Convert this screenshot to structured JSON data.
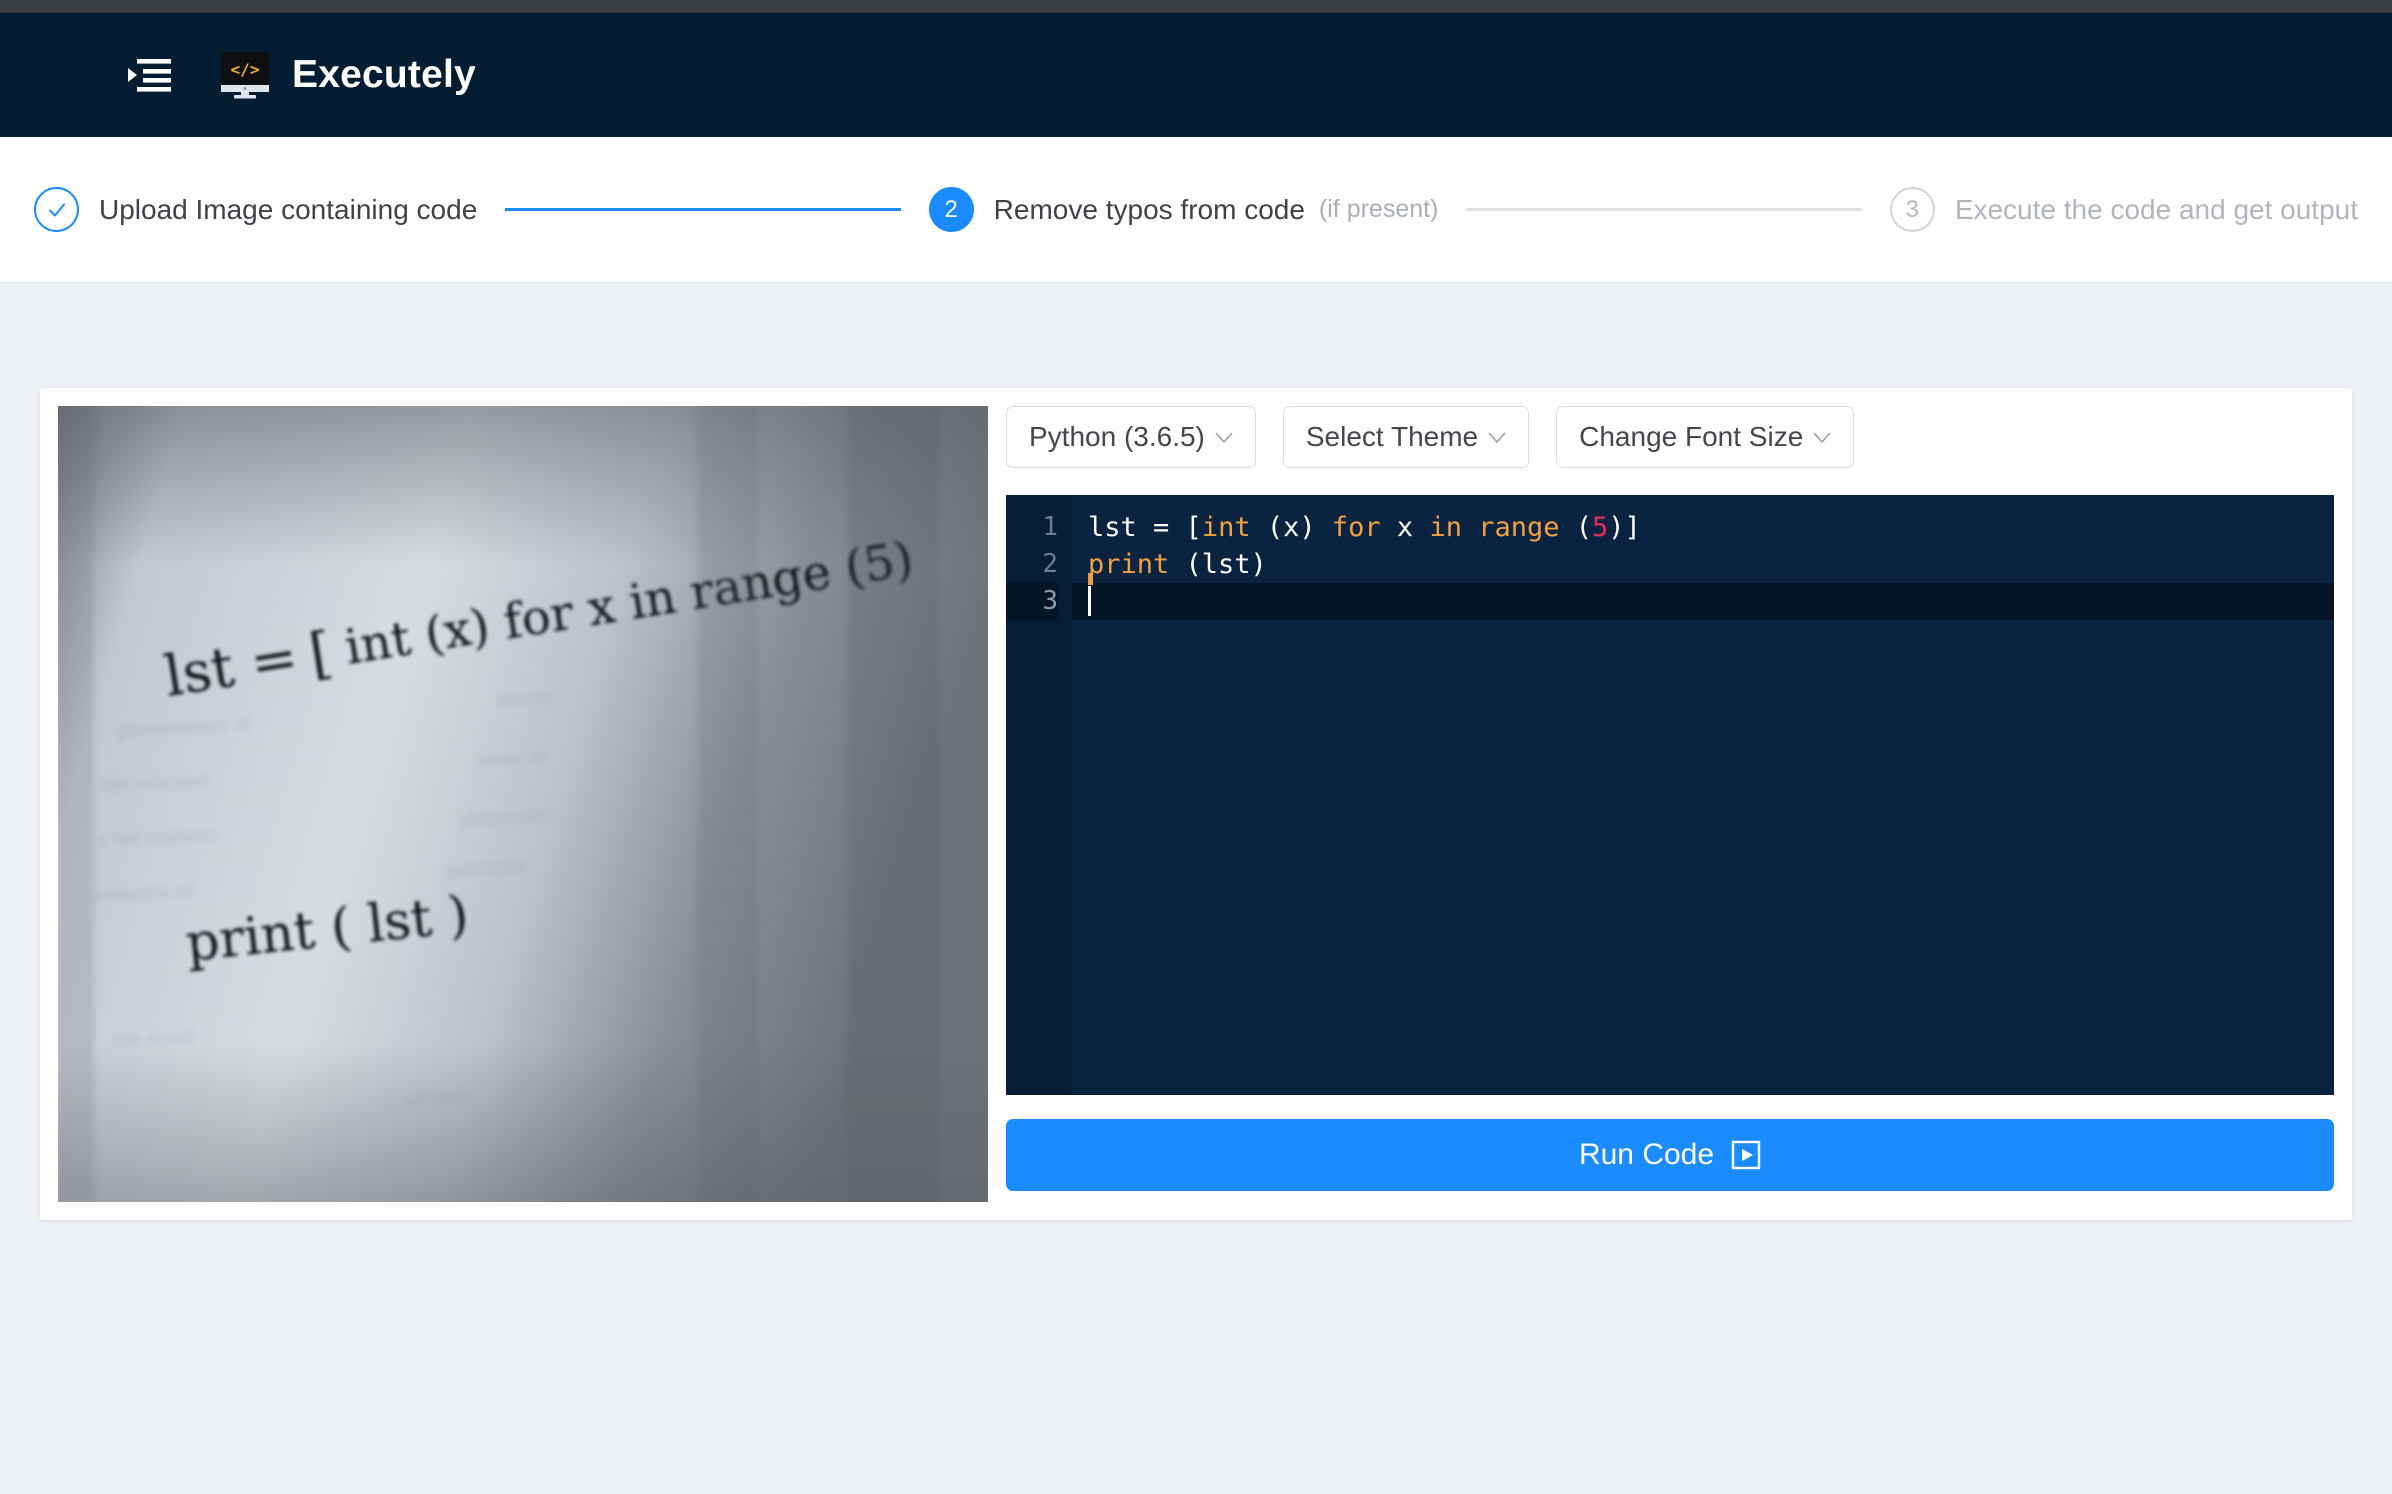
{
  "header": {
    "menu_icon": "indent-list-icon",
    "logo_icon": "monitor-code-icon",
    "title": "Executely",
    "background_color": "#051d33",
    "accent_color": "#1a8cff"
  },
  "stepper": {
    "steps": [
      {
        "number": "1",
        "state": "done",
        "bullet_glyph": "check-icon",
        "label": "Upload Image containing code",
        "sub": ""
      },
      {
        "number": "2",
        "state": "active",
        "bullet_glyph": "2",
        "label": "Remove typos from code",
        "sub": "(if present)"
      },
      {
        "number": "3",
        "state": "todo",
        "bullet_glyph": "3",
        "label": "Execute the code and get output",
        "sub": ""
      }
    ],
    "connectors": [
      "filled",
      "empty"
    ]
  },
  "image_panel": {
    "name": "uploaded-code-photo",
    "alt": "Photograph of handwritten code on a whiteboard",
    "handwritten_lines": [
      "lst = [int(x) for x in range(5)]",
      "print (lst)"
    ]
  },
  "toolbar": {
    "language_select": "Python (3.6.5)",
    "theme_select": "Select Theme",
    "font_size_select": "Change Font Size",
    "caret_icon": "chevron-down-icon"
  },
  "editor": {
    "background_color": "#0a2340",
    "gutter_color": "#071d36",
    "active_line_color": "#041525",
    "keyword_color": "#f0a040",
    "number_color": "#e8305e",
    "text_color": "#ffffff",
    "line_numbers": [
      "1",
      "2",
      "3"
    ],
    "active_line": 3,
    "lines": [
      {
        "number": "1",
        "tokens": [
          {
            "t": "lst ",
            "c": "txt"
          },
          {
            "t": "= ",
            "c": "txt"
          },
          {
            "t": "[",
            "c": "txt"
          },
          {
            "t": "int",
            "c": "kw"
          },
          {
            "t": " (x) ",
            "c": "txt"
          },
          {
            "t": "for",
            "c": "kw"
          },
          {
            "t": " x ",
            "c": "txt"
          },
          {
            "t": "in",
            "c": "kw"
          },
          {
            "t": " ",
            "c": "txt"
          },
          {
            "t": "range",
            "c": "kw"
          },
          {
            "t": " (",
            "c": "txt"
          },
          {
            "t": "5",
            "c": "num"
          },
          {
            "t": ")]",
            "c": "txt"
          }
        ],
        "plain": "lst = [int (x) for x in range (5)]"
      },
      {
        "number": "2",
        "tokens": [
          {
            "t": "print",
            "c": "kw"
          },
          {
            "t": " (lst)",
            "c": "txt"
          }
        ],
        "plain": "print (lst)"
      },
      {
        "number": "3",
        "tokens": [],
        "plain": ""
      }
    ]
  },
  "run_button": {
    "label": "Run Code",
    "icon": "play-in-box-icon",
    "color": "#1a8cff"
  },
  "page": {
    "background_color": "#eef1f5"
  }
}
